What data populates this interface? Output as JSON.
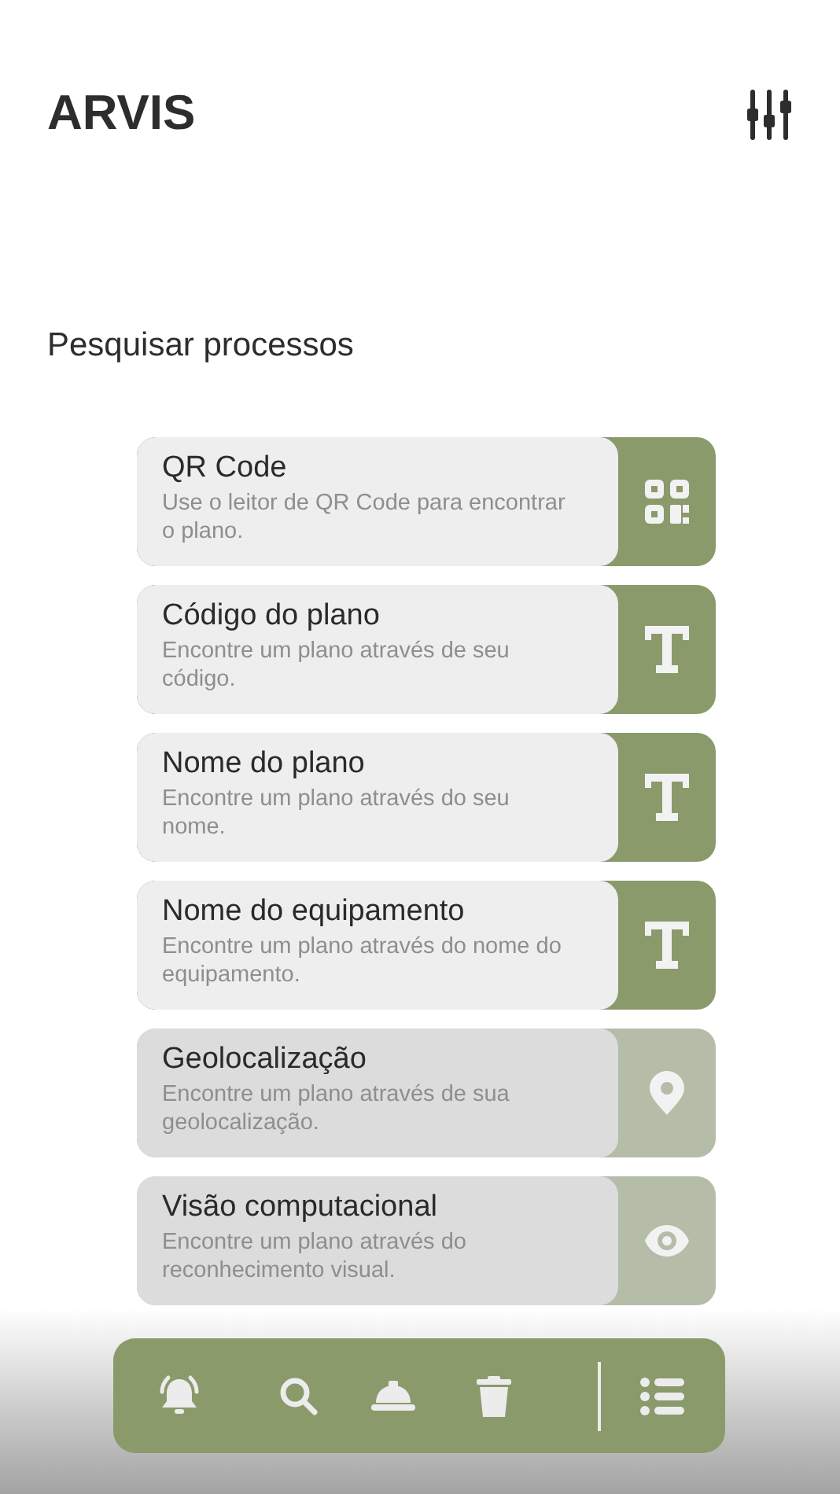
{
  "app_title": "ARVIS",
  "section_title": "Pesquisar processos",
  "options": [
    {
      "title": "QR Code",
      "description": "Use o leitor de QR Code para encontrar o plano.",
      "kind": "qr",
      "disabled": false
    },
    {
      "title": "Código do plano",
      "description": "Encontre um plano através de seu código.",
      "kind": "text",
      "disabled": false
    },
    {
      "title": "Nome do plano",
      "description": "Encontre um plano através do seu nome.",
      "kind": "text",
      "disabled": false
    },
    {
      "title": "Nome do equipamento",
      "description": "Encontre um plano através do nome do equipamento.",
      "kind": "text",
      "disabled": false
    },
    {
      "title": "Geolocalização",
      "description": "Encontre um plano através de sua geolocalização.",
      "kind": "pin",
      "disabled": true
    },
    {
      "title": "Visão computacional",
      "description": "Encontre um plano através do reconhecimento visual.",
      "kind": "eye",
      "disabled": true
    }
  ]
}
